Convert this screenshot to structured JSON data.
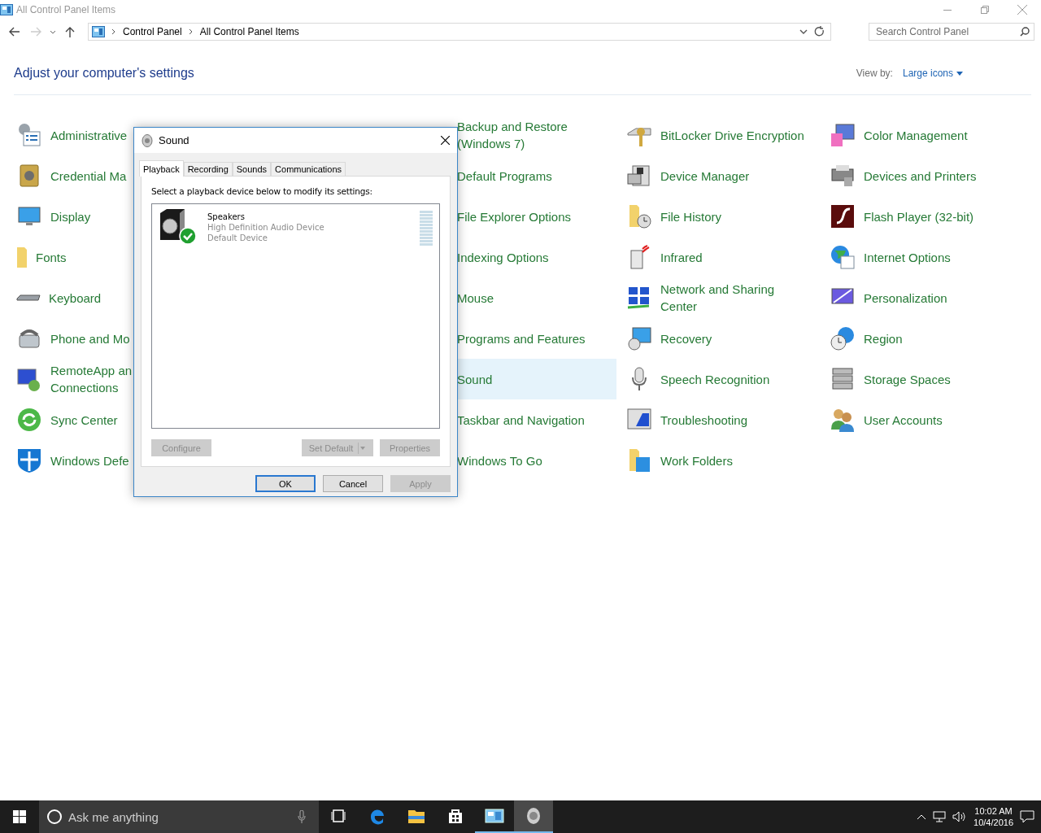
{
  "window": {
    "title": "All Control Panel Items"
  },
  "address_bar": {
    "path": [
      "Control Panel",
      "All Control Panel Items"
    ]
  },
  "search": {
    "placeholder": "Search Control Panel"
  },
  "heading": "Adjust your computer's settings",
  "view_by": {
    "label": "View by:",
    "value": "Large icons"
  },
  "columns": [
    {
      "items": [
        {
          "label": "Administrative",
          "selected": false
        },
        {
          "label": "Credential Ma",
          "selected": false
        },
        {
          "label": "Display",
          "selected": false
        },
        {
          "label": "Fonts",
          "selected": false
        },
        {
          "label": "Keyboard",
          "selected": false
        },
        {
          "label": "Phone and Mo",
          "selected": false
        },
        {
          "label": "RemoteApp an\nConnections",
          "selected": false
        },
        {
          "label": "Sync Center",
          "selected": false
        },
        {
          "label": "Windows Defe",
          "selected": false
        }
      ]
    },
    {
      "items": [
        {
          "label": "Backup and Restore\n(Windows 7)",
          "selected": false
        },
        {
          "label": "Default Programs",
          "selected": false
        },
        {
          "label": "File Explorer Options",
          "selected": false
        },
        {
          "label": "Indexing Options",
          "selected": false
        },
        {
          "label": "Mouse",
          "selected": false
        },
        {
          "label": "Programs and Features",
          "selected": false
        },
        {
          "label": "Sound",
          "selected": true
        },
        {
          "label": "Taskbar and Navigation",
          "selected": false
        },
        {
          "label": "Windows To Go",
          "selected": false
        }
      ]
    },
    {
      "items": [
        {
          "label": "BitLocker Drive Encryption",
          "selected": false
        },
        {
          "label": "Device Manager",
          "selected": false
        },
        {
          "label": "File History",
          "selected": false
        },
        {
          "label": "Infrared",
          "selected": false
        },
        {
          "label": "Network and Sharing\nCenter",
          "selected": false
        },
        {
          "label": "Recovery",
          "selected": false
        },
        {
          "label": "Speech Recognition",
          "selected": false
        },
        {
          "label": "Troubleshooting",
          "selected": false
        },
        {
          "label": "Work Folders",
          "selected": false
        }
      ]
    },
    {
      "items": [
        {
          "label": "Color Management",
          "selected": false
        },
        {
          "label": "Devices and Printers",
          "selected": false
        },
        {
          "label": "Flash Player (32-bit)",
          "selected": false
        },
        {
          "label": "Internet Options",
          "selected": false
        },
        {
          "label": "Personalization",
          "selected": false
        },
        {
          "label": "Region",
          "selected": false
        },
        {
          "label": "Storage Spaces",
          "selected": false
        },
        {
          "label": "User Accounts",
          "selected": false
        }
      ]
    }
  ],
  "dialog": {
    "title": "Sound",
    "tabs": [
      {
        "label": "Playback",
        "selected": true
      },
      {
        "label": "Recording",
        "selected": false
      },
      {
        "label": "Sounds",
        "selected": false
      },
      {
        "label": "Communications",
        "selected": false
      }
    ],
    "instruction": "Select a playback device below to modify its settings:",
    "devices": [
      {
        "name": "Speakers",
        "driver": "High Definition Audio Device",
        "status": "Default Device",
        "default": true
      }
    ],
    "device_buttons": [
      {
        "label": "Configure",
        "disabled": true
      },
      {
        "label": "Set Default",
        "disabled": true,
        "kind": "split"
      },
      {
        "label": "Properties",
        "disabled": true
      }
    ],
    "buttons": [
      {
        "label": "OK",
        "disabled": false,
        "default": true
      },
      {
        "label": "Cancel",
        "disabled": false,
        "default": false
      },
      {
        "label": "Apply",
        "disabled": true,
        "default": false
      }
    ]
  },
  "taskbar": {
    "search_placeholder": "Ask me anything",
    "apps": [
      {
        "running": false,
        "selected": false
      },
      {
        "running": false,
        "selected": false
      },
      {
        "running": false,
        "selected": false
      },
      {
        "running": false,
        "selected": false
      },
      {
        "running": true,
        "selected": false
      },
      {
        "running": true,
        "selected": true
      }
    ],
    "time": "10:02 AM",
    "date": "10/4/2016"
  }
}
